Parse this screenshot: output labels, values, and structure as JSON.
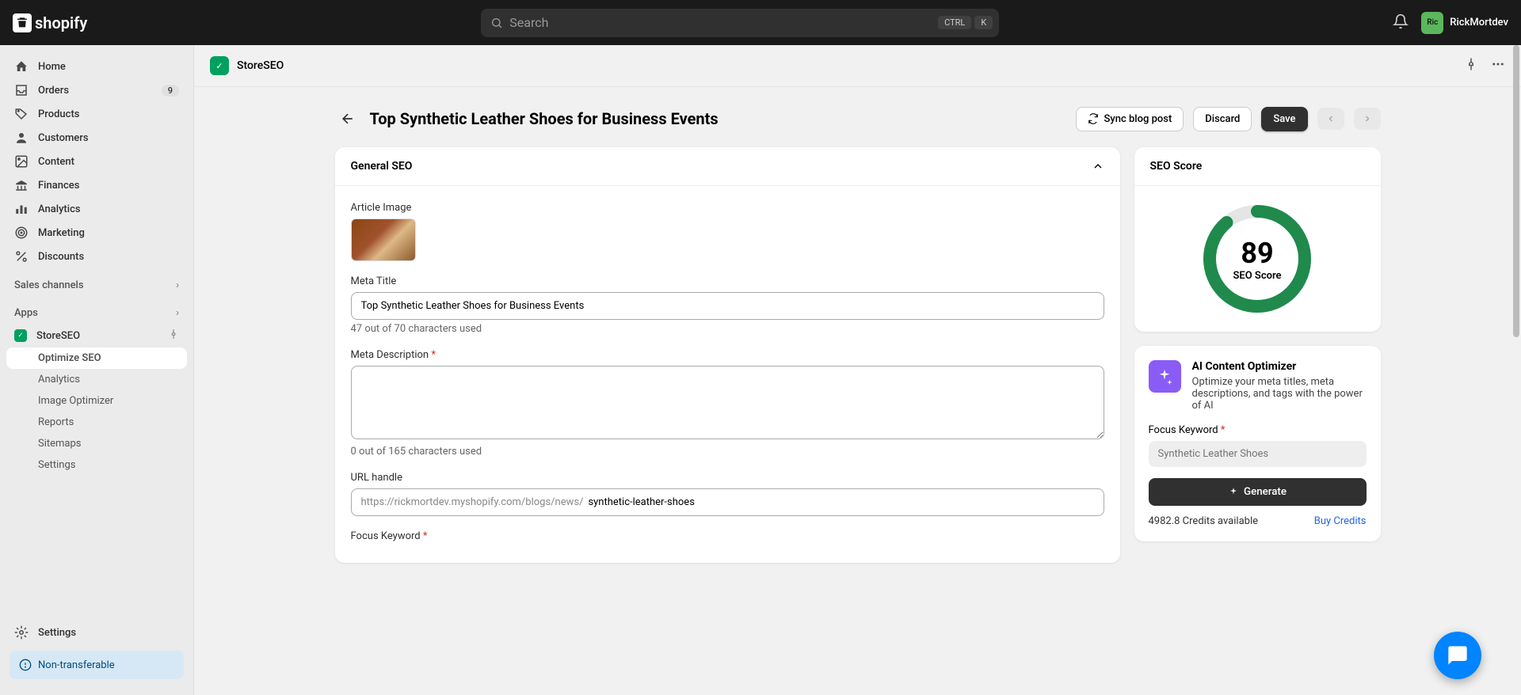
{
  "topbar": {
    "logo_text": "shopify",
    "search_placeholder": "Search",
    "kbd1": "CTRL",
    "kbd2": "K",
    "username": "RickMortdev",
    "avatar_initials": "Ric"
  },
  "sidebar": {
    "items": [
      {
        "icon": "home",
        "label": "Home"
      },
      {
        "icon": "inbox",
        "label": "Orders",
        "badge": "9"
      },
      {
        "icon": "tag",
        "label": "Products"
      },
      {
        "icon": "user",
        "label": "Customers"
      },
      {
        "icon": "image",
        "label": "Content"
      },
      {
        "icon": "bank",
        "label": "Finances"
      },
      {
        "icon": "chart",
        "label": "Analytics"
      },
      {
        "icon": "target",
        "label": "Marketing"
      },
      {
        "icon": "percent",
        "label": "Discounts"
      }
    ],
    "sales_channels_label": "Sales channels",
    "apps_label": "Apps",
    "app_name": "StoreSEO",
    "app_subitems": [
      {
        "label": "Optimize SEO",
        "active": true
      },
      {
        "label": "Analytics"
      },
      {
        "label": "Image Optimizer"
      },
      {
        "label": "Reports"
      },
      {
        "label": "Sitemaps"
      },
      {
        "label": "Settings"
      }
    ],
    "settings_label": "Settings",
    "non_transferable": "Non-transferable"
  },
  "app_header": {
    "title": "StoreSEO"
  },
  "page": {
    "title": "Top Synthetic Leather Shoes for Business Events",
    "sync_label": "Sync blog post",
    "discard_label": "Discard",
    "save_label": "Save"
  },
  "general_seo": {
    "header": "General SEO",
    "article_image_label": "Article Image",
    "meta_title_label": "Meta Title",
    "meta_title_value": "Top Synthetic Leather Shoes for Business Events",
    "meta_title_hint": "47 out of 70 characters used",
    "meta_description_label": "Meta Description",
    "meta_description_value": "",
    "meta_description_hint": "0 out of 165 characters used",
    "url_handle_label": "URL handle",
    "url_prefix": "https://rickmortdev.myshopify.com/blogs/news/",
    "url_slug": "synthetic-leather-shoes",
    "focus_keyword_label": "Focus Keyword"
  },
  "seo_score": {
    "header": "SEO Score",
    "score": "89",
    "score_label": "SEO Score"
  },
  "ai_optimizer": {
    "title": "AI Content Optimizer",
    "description": "Optimize your meta titles, meta descriptions, and tags with the power of AI",
    "focus_keyword_label": "Focus Keyword",
    "focus_keyword_placeholder": "Synthetic Leather Shoes",
    "generate_label": "Generate",
    "credits_text": "4982.8 Credits available",
    "buy_credits_label": "Buy Credits"
  }
}
